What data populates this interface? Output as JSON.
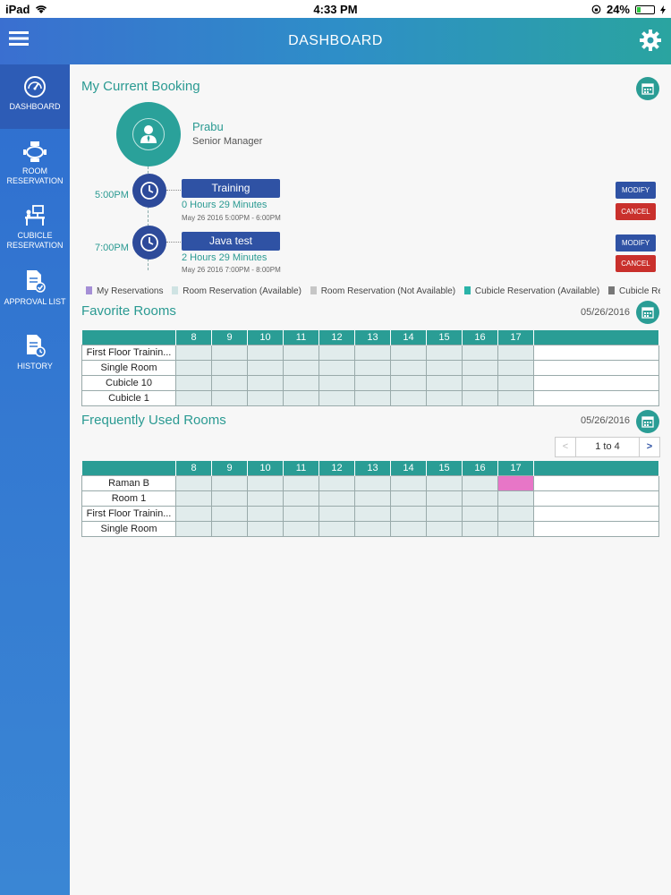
{
  "status_bar": {
    "device": "iPad",
    "time": "4:33 PM",
    "battery": "24%",
    "battery_level": 0.24
  },
  "header": {
    "title": "DASHBOARD",
    "menu_icon": "menu-icon",
    "settings_icon": "gear-icon"
  },
  "sidebar": {
    "items": [
      {
        "label": "DASHBOARD",
        "icon": "speedometer-icon",
        "active": true
      },
      {
        "label": "ROOM RESERVATION",
        "icon": "conference-table-icon"
      },
      {
        "label": "CUBICLE RESERVATION",
        "icon": "cubicle-desk-icon"
      },
      {
        "label": "APPROVAL LIST",
        "icon": "document-check-icon"
      },
      {
        "label": "HISTORY",
        "icon": "document-clock-icon"
      }
    ]
  },
  "current_booking": {
    "title": "My Current Booking",
    "user": {
      "name": "Prabu",
      "role": "Senior Manager"
    },
    "bookings": [
      {
        "time": "5:00PM",
        "title": "Training",
        "duration": "0 Hours 29 Minutes",
        "date": "May 26 2016  5:00PM - 6:00PM",
        "modify": "MODIFY",
        "cancel": "CANCEL"
      },
      {
        "time": "7:00PM",
        "title": "Java test",
        "duration": "2 Hours 29 Minutes",
        "date": "May 26 2016  7:00PM - 8:00PM",
        "modify": "MODIFY",
        "cancel": "CANCEL"
      }
    ]
  },
  "legend": [
    {
      "label": "My Reservations",
      "color": "#a58fd6"
    },
    {
      "label": "Room Reservation (Available)",
      "color": "#cfe3e3"
    },
    {
      "label": "Room Reservation (Not Available)",
      "color": "#c6c6c6"
    },
    {
      "label": "Cubicle Reservation (Available)",
      "color": "#2ab3a8"
    },
    {
      "label": "Cubicle Re",
      "color": "#777777"
    }
  ],
  "favorite_rooms": {
    "title": "Favorite Rooms",
    "date": "05/26/2016",
    "hours": [
      "8",
      "9",
      "10",
      "11",
      "12",
      "13",
      "14",
      "15",
      "16",
      "17"
    ],
    "rooms": [
      "First Floor Trainin...",
      "Single Room",
      "Cubicle 10",
      "Cubicle 1"
    ]
  },
  "frequent_rooms": {
    "title": "Frequently Used Rooms",
    "date": "05/26/2016",
    "pager": {
      "prev": "<",
      "text": "1 to 4",
      "next": ">"
    },
    "hours": [
      "8",
      "9",
      "10",
      "11",
      "12",
      "13",
      "14",
      "15",
      "16",
      "17"
    ],
    "rooms": [
      "Raman B",
      "Room 1",
      "First Floor Trainin...",
      "Single Room"
    ],
    "booked": [
      {
        "room": "Raman B",
        "hour": "17"
      }
    ],
    "booked_color": "#e776c7"
  }
}
